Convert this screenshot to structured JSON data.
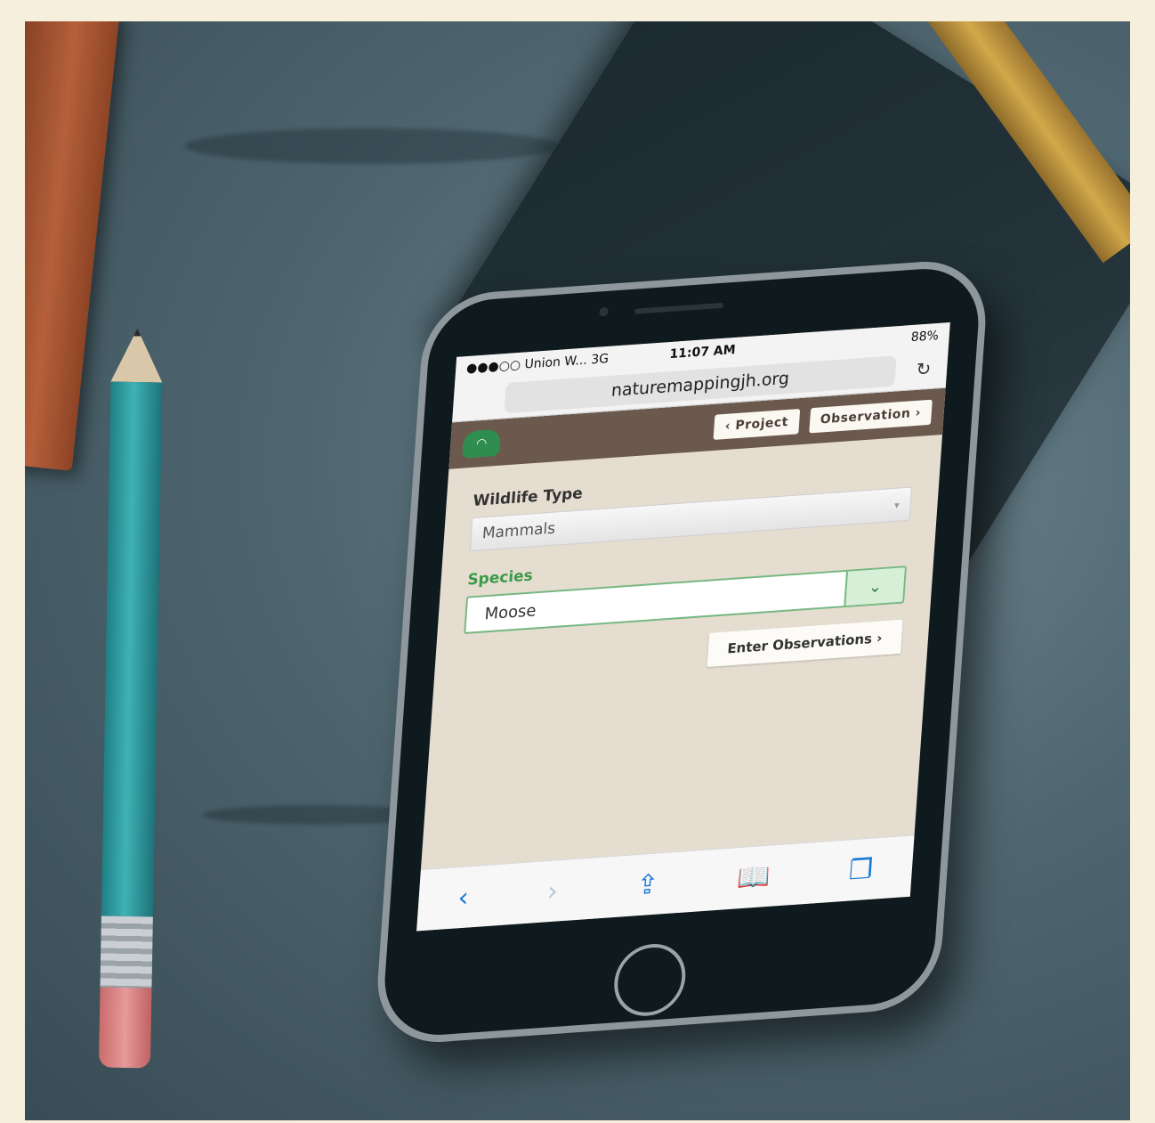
{
  "statusbar": {
    "carrier": "●●●○○ Union W...  3G",
    "time": "11:07 AM",
    "battery": "88%"
  },
  "browser": {
    "url": "naturemappingjh.org"
  },
  "app": {
    "nav_back_label": "Project",
    "nav_forward_label": "Observation"
  },
  "form": {
    "wildlife_type_label": "Wildlife Type",
    "wildlife_type_value": "Mammals",
    "species_label": "Species",
    "species_value": "Moose",
    "enter_button_label": "Enter Observations"
  },
  "icons": {
    "logo": "wifi-cloud-icon",
    "reload": "reload-icon",
    "back": "chevron-left-icon",
    "forward": "chevron-right-icon",
    "share": "share-icon",
    "bookmarks": "book-icon",
    "tabs": "tabs-icon",
    "dropdown": "chevron-down-icon"
  },
  "colors": {
    "appbar": "#6b594d",
    "accent_green": "#3c9a48",
    "safari_blue": "#1b7ad6"
  }
}
